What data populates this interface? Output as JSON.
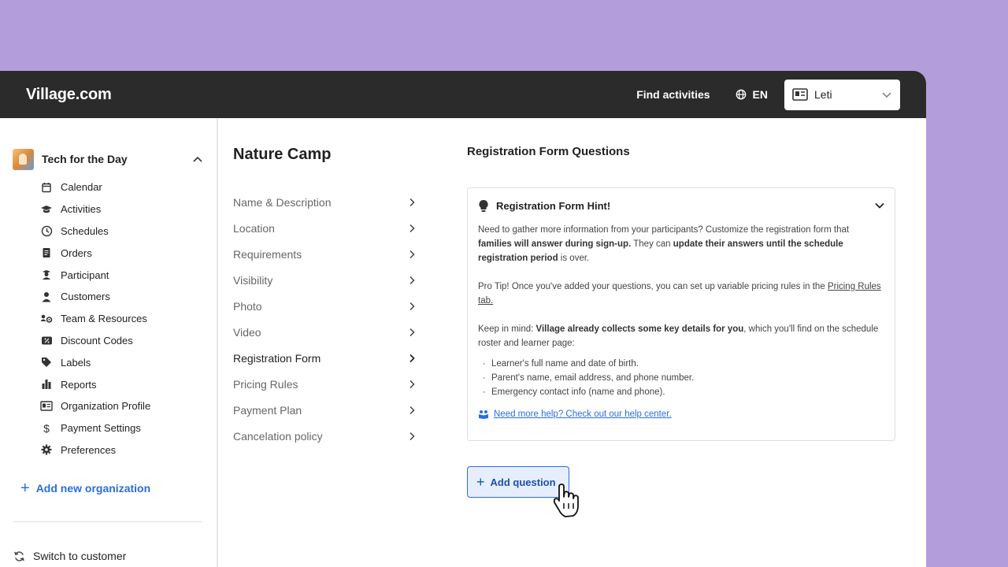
{
  "brand": {
    "name": "Village.com"
  },
  "header": {
    "find_label": "Find activities",
    "lang_label": "EN",
    "user_name": "Leti"
  },
  "sidebar": {
    "org_name": "Tech for the Day",
    "items": [
      {
        "label": "Calendar",
        "icon": "calendar-icon"
      },
      {
        "label": "Activities",
        "icon": "graduation-cap-icon"
      },
      {
        "label": "Schedules",
        "icon": "clock-icon"
      },
      {
        "label": "Orders",
        "icon": "receipt-icon"
      },
      {
        "label": "Participant",
        "icon": "student-icon"
      },
      {
        "label": "Customers",
        "icon": "person-icon"
      },
      {
        "label": "Team & Resources",
        "icon": "team-icon"
      },
      {
        "label": "Discount Codes",
        "icon": "discount-icon"
      },
      {
        "label": "Labels",
        "icon": "tag-icon"
      },
      {
        "label": "Reports",
        "icon": "bar-chart-icon"
      },
      {
        "label": "Organization Profile",
        "icon": "id-card-icon"
      },
      {
        "label": "Payment Settings",
        "icon": "dollar-icon"
      },
      {
        "label": "Preferences",
        "icon": "gear-icon"
      }
    ],
    "add_org_label": "Add new organization",
    "switch_label": "Switch to customer"
  },
  "middle": {
    "title": "Nature Camp",
    "items": [
      {
        "label": "Name & Description"
      },
      {
        "label": "Location"
      },
      {
        "label": "Requirements"
      },
      {
        "label": "Visibility"
      },
      {
        "label": "Photo"
      },
      {
        "label": "Video"
      },
      {
        "label": "Registration Form",
        "active": true
      },
      {
        "label": "Pricing Rules"
      },
      {
        "label": "Payment Plan"
      },
      {
        "label": "Cancelation policy"
      }
    ]
  },
  "main": {
    "section_title": "Registration Form Questions",
    "hint": {
      "title": "Registration Form Hint!",
      "p1_a": "Need to gather more information from your participants?  Customize the registration form that ",
      "p1_b": "families will answer during sign-up.",
      "p1_c": " They can ",
      "p1_d": "update their answers until the schedule registration period",
      "p1_e": " is over.",
      "p2_a": "Pro Tip! Once you've added your questions, you can set up variable pricing rules in the ",
      "p2_link": "Pricing Rules tab.",
      "p3_a": "Keep in mind: ",
      "p3_b": "Village already collects some key details for you",
      "p3_c": ", which you'll find on the schedule roster and learner page:",
      "bullets": [
        "Learner's full name and date of birth.",
        "Parent's name, email address, and phone number.",
        "Emergency contact info (name and phone)."
      ],
      "help_link": "Need more help? Check out our help center."
    },
    "add_question_label": "Add question"
  },
  "colors": {
    "background": "#b39ddb",
    "topbar": "#2b2b2b",
    "accent": "#2a6de0"
  }
}
